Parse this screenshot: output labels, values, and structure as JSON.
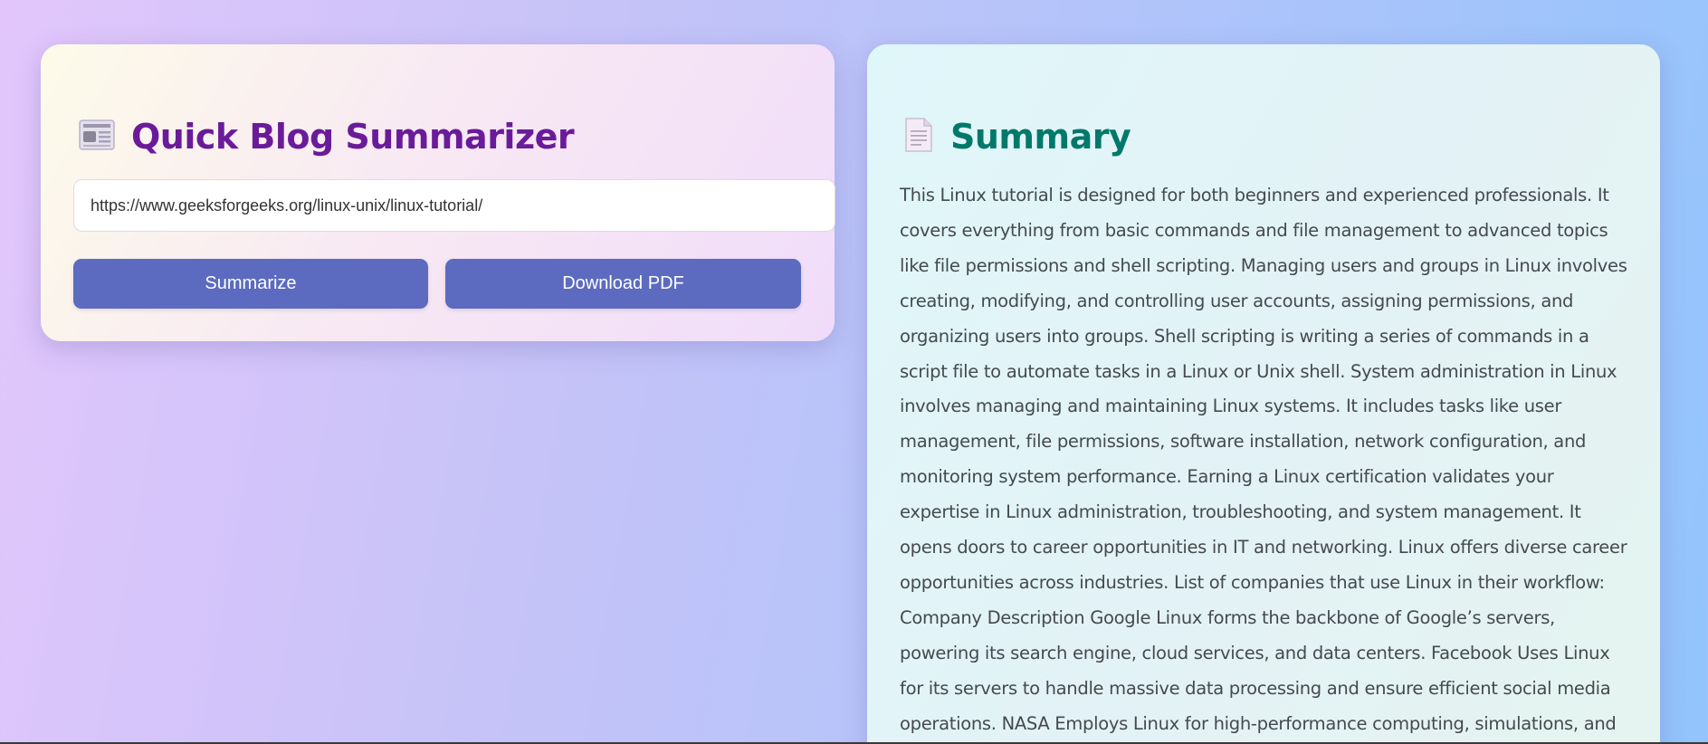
{
  "colors": {
    "left_title": "#6a1b9a",
    "right_title": "#00796b",
    "button_bg": "#5c6bc0",
    "button_text": "#ffffff"
  },
  "summarizer": {
    "icon": "newspaper-icon",
    "title": "Quick Blog Summarizer",
    "url_value": "https://www.geeksforgeeks.org/linux-unix/linux-tutorial/",
    "summarize_label": "Summarize",
    "download_label": "Download PDF"
  },
  "summary": {
    "icon": "document-icon",
    "title": "Summary",
    "text": "This Linux tutorial is designed for both beginners and experienced professionals. It covers everything from basic commands and file management to advanced topics like file permissions and shell scripting. Managing users and groups in Linux involves creating, modifying, and controlling user accounts, assigning permissions, and organizing users into groups. Shell scripting is writing a series of commands in a script file to automate tasks in a Linux or Unix shell. System administration in Linux involves managing and maintaining Linux systems. It includes tasks like user management, file permissions, software installation, network configuration, and monitoring system performance. Earning a Linux certification validates your expertise in Linux administration, troubleshooting, and system management. It opens doors to career opportunities in IT and networking. Linux offers diverse career opportunities across industries. List of companies that use Linux in their workflow: Company Description Google Linux forms the backbone of Google’s servers, powering its search engine, cloud services, and data centers. Facebook Uses Linux for its servers to handle massive data processing and ensure efficient social media operations. NASA Employs Linux for high-performance computing, simulations, and"
  }
}
